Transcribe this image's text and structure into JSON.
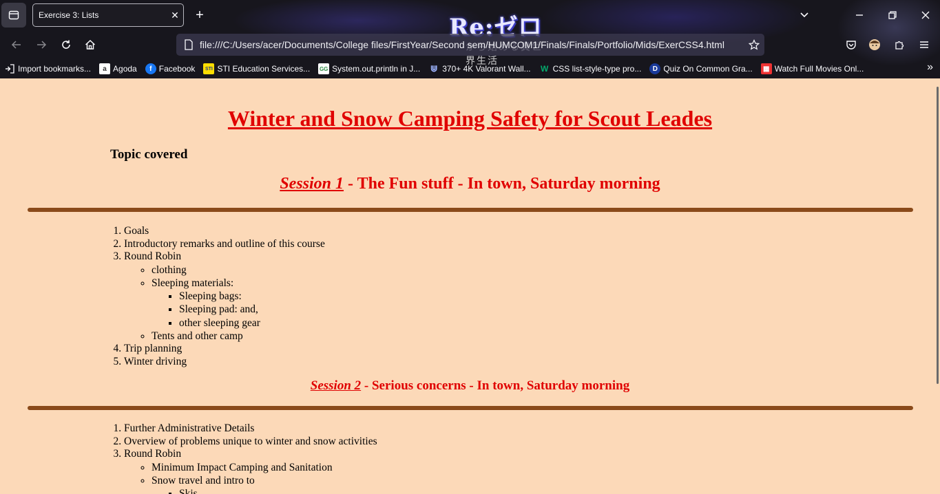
{
  "browser": {
    "tab_title": "Exercise 3: Lists",
    "tab_close": "✕",
    "new_tab": "+",
    "theme_logo_main": "Re:ゼロ",
    "theme_logo_sub": "から始める異世界生活",
    "url": "file:///C:/Users/acer/Documents/College files/FirstYear/Second sem/HUMCOM1/Finals/Finals/Portfolio/Mids/ExerCSS4.html",
    "bookmarks": [
      {
        "label": "Import bookmarks...",
        "icon": "import-icon"
      },
      {
        "label": "Agoda",
        "icon": "agoda-icon"
      },
      {
        "label": "Facebook",
        "icon": "facebook-icon"
      },
      {
        "label": "STI Education Services...",
        "icon": "sti-icon"
      },
      {
        "label": "System.out.println in J...",
        "icon": "geeksforgeeks-icon"
      },
      {
        "label": "370+ 4K Valorant Wall...",
        "icon": "wallpaper-icon"
      },
      {
        "label": "CSS list-style-type pro...",
        "icon": "w3schools-icon"
      },
      {
        "label": "Quiz On Common Gra...",
        "icon": "quiz-icon"
      },
      {
        "label": "Watch Full Movies Onl...",
        "icon": "movies-icon"
      }
    ]
  },
  "content": {
    "title": "Winter and Snow Camping Safety for Scout Leades",
    "topic": "Topic covered",
    "session1": {
      "label": "Session 1",
      "rest": " - The Fun stuff - In town, Saturday morning",
      "items": [
        {
          "text": "Goals"
        },
        {
          "text": "Introductory remarks and outline of this course"
        },
        {
          "text": "Round Robin"
        },
        {
          "text": "Trip planning"
        },
        {
          "text": "Winter driving"
        }
      ],
      "round_robin": [
        "clothing",
        "Sleeping materials:",
        "Tents and other camp"
      ],
      "sleeping_materials": [
        "Sleeping bags:",
        "Sleeping pad: and,",
        "other sleeping gear"
      ]
    },
    "session2": {
      "label": "Session 2",
      "rest": " - Serious concerns - In town, Saturday morning",
      "items": [
        {
          "text": "Further Administrative Details"
        },
        {
          "text": "Overview of problems unique to winter and snow activities"
        },
        {
          "text": "Round Robin"
        }
      ],
      "round_robin": [
        "Minimum Impact Camping and Sanitation",
        "Snow travel and intro to"
      ],
      "snow_travel": [
        "Skis"
      ]
    }
  },
  "colors": {
    "page_background": "#fcd9b8",
    "heading_red": "#e00000",
    "rule_brown": "#8a4a1a"
  }
}
